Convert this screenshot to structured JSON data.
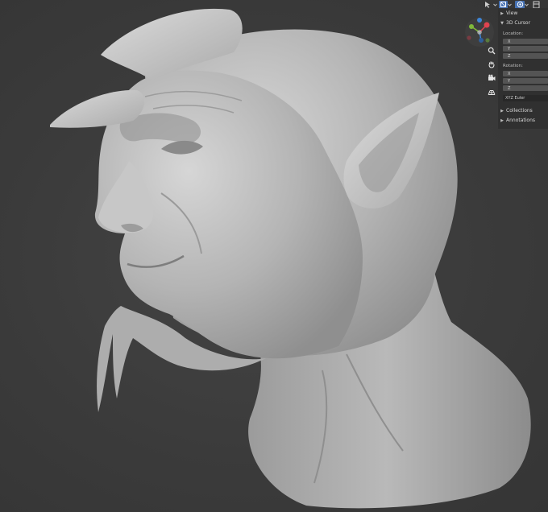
{
  "header": {
    "icons": [
      "cursor-tool-icon",
      "viewport-shading-icon",
      "overlay-icon",
      "editor-type-icon"
    ]
  },
  "gizmo": {
    "axes": {
      "x": "X",
      "y": "Y",
      "z": "Z"
    },
    "colors": {
      "x": "#e0434f",
      "y": "#7fb83a",
      "z": "#3e86d8"
    }
  },
  "nav_tools": [
    "zoom-icon",
    "hand-pan-icon",
    "camera-icon",
    "grid-view-icon"
  ],
  "npanel": {
    "view_label": "View",
    "cursor_label": "3D Cursor",
    "location_label": "Location:",
    "location_axes": [
      "X",
      "Y",
      "Z"
    ],
    "rotation_label": "Rotation:",
    "rotation_axes": [
      "X",
      "Y",
      "Z"
    ],
    "rotation_mode": "XYZ Euler",
    "collections_label": "Collections",
    "annotations_label": "Annotations"
  },
  "colors": {
    "background": "#3d3d3d",
    "panel": "#303030",
    "field": "#545454",
    "clay": "#b9b9b9"
  }
}
